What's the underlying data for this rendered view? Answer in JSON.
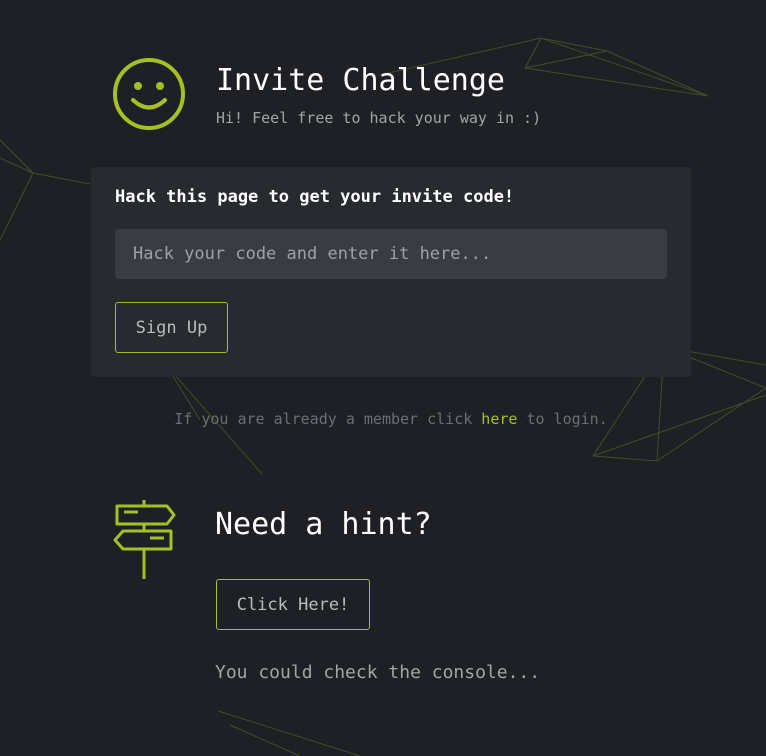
{
  "header": {
    "title": "Invite Challenge",
    "subtitle": "Hi! Feel free to hack your way in :)",
    "icon": "smiley-icon"
  },
  "invite_form": {
    "heading": "Hack this page to get your invite code!",
    "input_placeholder": "Hack your code and enter it here...",
    "input_value": "",
    "signup_label": "Sign Up"
  },
  "login_prompt": {
    "before": "If you are already a member click ",
    "link": "here",
    "after": " to login."
  },
  "hint": {
    "icon": "signpost-icon",
    "title": "Need a hint?",
    "button_label": "Click Here!",
    "text": "You could check the console..."
  },
  "colors": {
    "background": "#1e2025",
    "card": "#272a2e",
    "input": "#393d43",
    "accent": "#a5c023",
    "muted_text": "#a2a4a8"
  }
}
